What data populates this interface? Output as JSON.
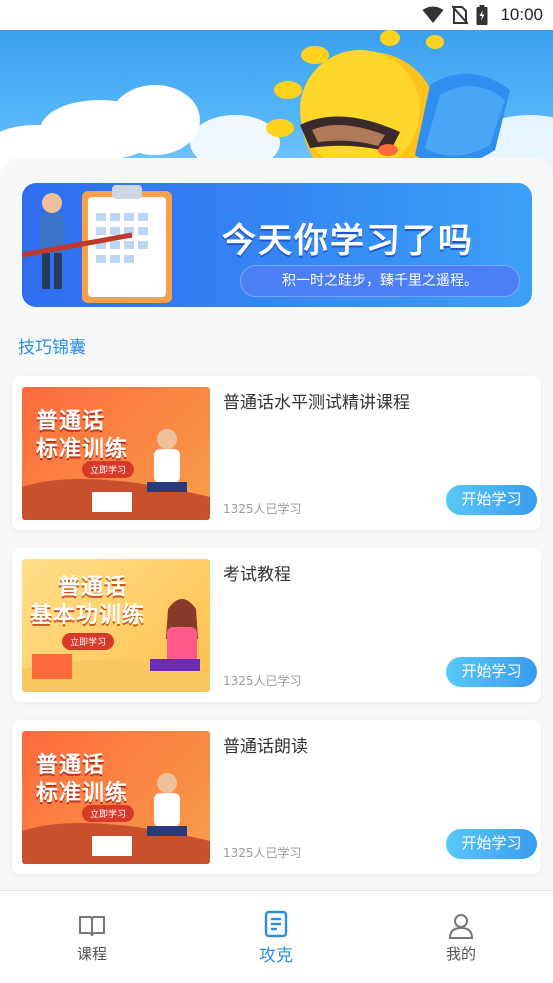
{
  "status_bar": {
    "time": "10:00",
    "icons": [
      "wifi-icon",
      "no-sim-icon",
      "battery-charging-icon"
    ]
  },
  "banner": {
    "title": "今天你学习了吗",
    "subtitle": "积一时之跬步，臻千里之遥程。"
  },
  "section": {
    "title": "技巧锦囊"
  },
  "courses": [
    {
      "title": "普通话水平测试精讲课程",
      "learners": "1325人已学习",
      "button": "开始学习",
      "thumb_title_line1": "普通话",
      "thumb_title_line2": "标准训练",
      "thumb_pill": "立即学习",
      "thumb_colors": [
        "#ff6a3d",
        "#f6a04a"
      ]
    },
    {
      "title": "考试教程",
      "learners": "1325人已学习",
      "button": "开始学习",
      "thumb_title_line1": "普通话",
      "thumb_title_line2": "基本功训练",
      "thumb_pill": "立即学习",
      "thumb_colors": [
        "#ffd86b",
        "#ffbf4d"
      ]
    },
    {
      "title": "普通话朗读",
      "learners": "1325人已学习",
      "button": "开始学习",
      "thumb_title_line1": "普通话",
      "thumb_title_line2": "标准训练",
      "thumb_pill": "立即学习",
      "thumb_colors": [
        "#ff6a3d",
        "#f6a04a"
      ]
    }
  ],
  "bottom_nav": {
    "items": [
      {
        "label": "课程",
        "icon": "book-icon",
        "active": false
      },
      {
        "label": "攻克",
        "icon": "scroll-icon",
        "active": true
      },
      {
        "label": "我的",
        "icon": "user-icon",
        "active": false
      }
    ]
  },
  "colors": {
    "accent": "#2a8ee6",
    "button_gradient_start": "#58c8f7",
    "button_gradient_end": "#3a9cf0",
    "banner_start": "#2f6df0",
    "banner_end": "#3aa0f6"
  }
}
